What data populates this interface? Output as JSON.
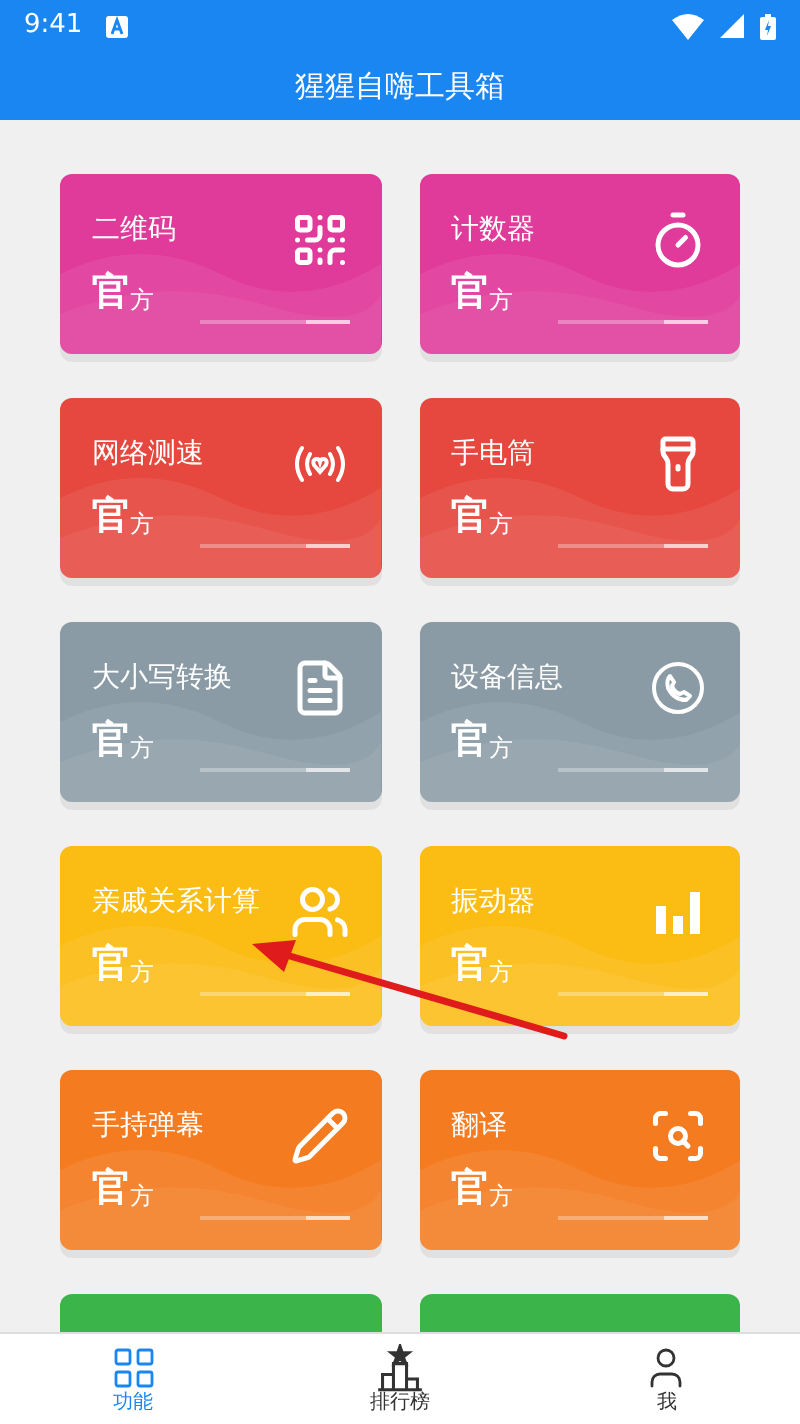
{
  "status_bar": {
    "time": "9:41"
  },
  "app_bar": {
    "title": "猩猩自嗨工具箱"
  },
  "cards": [
    {
      "title": "二维码",
      "badge_main": "官",
      "badge_sub": "方",
      "color": "#e03a9a"
    },
    {
      "title": "计数器",
      "badge_main": "官",
      "badge_sub": "方",
      "color": "#e03a9a"
    },
    {
      "title": "网络测速",
      "badge_main": "官",
      "badge_sub": "方",
      "color": "#e6483f"
    },
    {
      "title": "手电筒",
      "badge_main": "官",
      "badge_sub": "方",
      "color": "#e6483f"
    },
    {
      "title": "大小写转换",
      "badge_main": "官",
      "badge_sub": "方",
      "color": "#8a9ba6"
    },
    {
      "title": "设备信息",
      "badge_main": "官",
      "badge_sub": "方",
      "color": "#8a9ba6"
    },
    {
      "title": "亲戚关系计算",
      "badge_main": "官",
      "badge_sub": "方",
      "color": "#fbbd14"
    },
    {
      "title": "振动器",
      "badge_main": "官",
      "badge_sub": "方",
      "color": "#fbbd14"
    },
    {
      "title": "手持弹幕",
      "badge_main": "官",
      "badge_sub": "方",
      "color": "#f47b20"
    },
    {
      "title": "翻译",
      "badge_main": "官",
      "badge_sub": "方",
      "color": "#f47b20"
    },
    {
      "color": "#3bb54a"
    },
    {
      "color": "#3bb54a"
    }
  ],
  "tabs": [
    {
      "label": "功能",
      "selected": true
    },
    {
      "label": "排行榜",
      "selected": false
    },
    {
      "label": "我",
      "selected": false
    }
  ]
}
